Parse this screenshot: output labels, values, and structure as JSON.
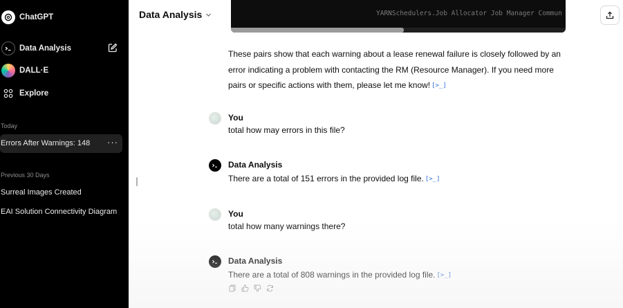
{
  "sidebar": {
    "app_name": "ChatGPT",
    "items": [
      {
        "label": "Data Analysis",
        "icon": "terminal-icon"
      },
      {
        "label": "DALL·E",
        "icon": "dalle-icon"
      },
      {
        "label": "Explore",
        "icon": "grid-icon"
      }
    ],
    "sections": [
      {
        "title": "Today",
        "chats": [
          "Errors After Warnings: 148"
        ]
      },
      {
        "title": "Previous 30 Days",
        "chats": [
          "Surreal Images Created",
          "EAI Solution Connectivity Diagram"
        ]
      }
    ],
    "more_label": "···"
  },
  "header": {
    "title": "Data Analysis"
  },
  "code_block": {
    "visible_text": "   YARNSchedulers.Job  Allocator  Job  Manager Commun"
  },
  "conversation": {
    "intro_text": "These pairs show that each warning about a lease renewal failure is closely followed by an error indicating a problem with contacting the RM (Resource Manager). If you need more pairs or specific actions with them, please let me know!",
    "code_link": "[>_]",
    "messages": [
      {
        "role": "user",
        "name": "You",
        "text": "total how may errors in this file?"
      },
      {
        "role": "assistant",
        "name": "Data Analysis",
        "text": "There are a total of 151 errors in the provided log file."
      },
      {
        "role": "user",
        "name": "You",
        "text": "total how many warnings there?"
      },
      {
        "role": "assistant",
        "name": "Data Analysis",
        "text": "There are a total of 808 warnings in the provided log file."
      }
    ]
  },
  "colors": {
    "sidebar_bg": "#000000",
    "active_chat_bg": "#212121",
    "link_blue": "#2f6fd6"
  }
}
